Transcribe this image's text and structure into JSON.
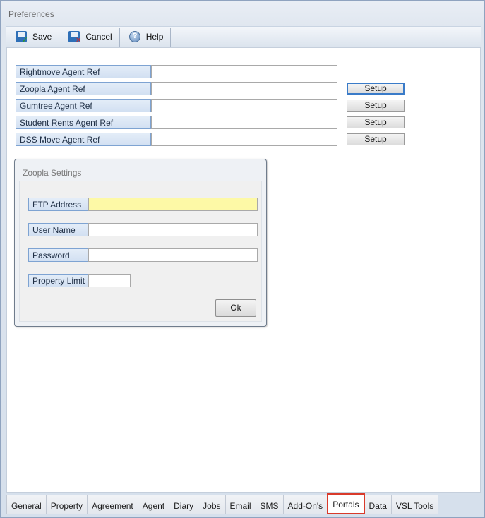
{
  "window": {
    "title": "Preferences"
  },
  "toolbar": {
    "save_label": "Save",
    "cancel_label": "Cancel",
    "help_label": "Help"
  },
  "portals": [
    {
      "label": "Rightmove Agent Ref",
      "value": "",
      "has_setup": false
    },
    {
      "label": "Zoopla Agent Ref",
      "value": "",
      "has_setup": true
    },
    {
      "label": "Gumtree Agent Ref",
      "value": "",
      "has_setup": true
    },
    {
      "label": "Student Rents Agent Ref",
      "value": "",
      "has_setup": true
    },
    {
      "label": "DSS Move Agent Ref",
      "value": "",
      "has_setup": true
    }
  ],
  "setup_label": "Setup",
  "dialog": {
    "title": "Zoopla Settings",
    "fields": [
      {
        "label": "FTP Address",
        "value": "",
        "highlight_color": "#fdf9a6"
      },
      {
        "label": "User Name",
        "value": ""
      },
      {
        "label": "Password",
        "value": ""
      },
      {
        "label": "Property Limit",
        "value": ""
      }
    ],
    "ok_label": "Ok"
  },
  "tabs": [
    {
      "label": "General",
      "active": false
    },
    {
      "label": "Property",
      "active": false
    },
    {
      "label": "Agreement",
      "active": false
    },
    {
      "label": "Agent",
      "active": false
    },
    {
      "label": "Diary",
      "active": false
    },
    {
      "label": "Jobs",
      "active": false
    },
    {
      "label": "Email",
      "active": false
    },
    {
      "label": "SMS",
      "active": false
    },
    {
      "label": "Add-On's",
      "active": false
    },
    {
      "label": "Portals",
      "active": true
    },
    {
      "label": "Data",
      "active": false
    },
    {
      "label": "VSL Tools",
      "active": false
    }
  ],
  "colors": {
    "label_border": "#7ea3d2",
    "active_tab_highlight": "#d93a2b",
    "focused_button": "#3a7bc8"
  }
}
